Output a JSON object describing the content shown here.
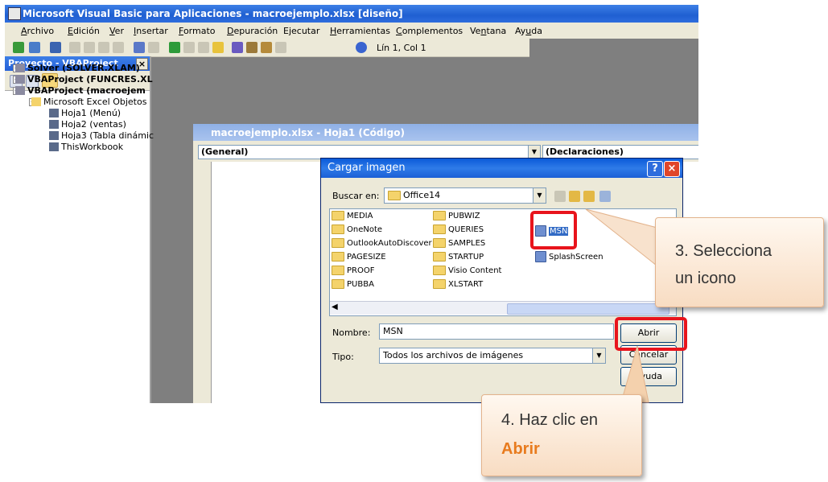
{
  "window": {
    "title": "Microsoft Visual Basic para Aplicaciones - macroejemplo.xlsx [diseño]"
  },
  "menu": [
    {
      "pre": "",
      "u": "A",
      "post": "rchivo"
    },
    {
      "pre": "",
      "u": "E",
      "post": "dición"
    },
    {
      "pre": "",
      "u": "V",
      "post": "er"
    },
    {
      "pre": "",
      "u": "I",
      "post": "nsertar"
    },
    {
      "pre": "",
      "u": "F",
      "post": "ormato"
    },
    {
      "pre": "",
      "u": "D",
      "post": "epuración"
    },
    {
      "pre": "E",
      "u": "j",
      "post": "ecutar"
    },
    {
      "pre": "",
      "u": "H",
      "post": "erramientas"
    },
    {
      "pre": "",
      "u": "C",
      "post": "omplementos"
    },
    {
      "pre": "Ve",
      "u": "n",
      "post": "tana"
    },
    {
      "pre": "Ay",
      "u": "u",
      "post": "da"
    }
  ],
  "toolbar": {
    "cursor_position": "Lín 1, Col 1"
  },
  "project_panel": {
    "title": "Proyecto - VBAProject",
    "close": "×",
    "tree": [
      {
        "label": "Solver (SOLVER.XLAM)",
        "bold": true
      },
      {
        "label": "VBAProject (FUNCRES.XL",
        "bold": true
      },
      {
        "label": "VBAProject (macroejem",
        "bold": true
      },
      {
        "label": "Microsoft Excel Objetos",
        "bold": false
      },
      {
        "label": "Hoja1 (Menú)",
        "bold": false
      },
      {
        "label": "Hoja2 (ventas)",
        "bold": false
      },
      {
        "label": "Hoja3 (Tabla dinámic",
        "bold": false
      },
      {
        "label": "ThisWorkbook",
        "bold": false
      }
    ]
  },
  "code_window": {
    "title": "macroejemplo.xlsx - Hoja1 (Código)",
    "object_combo": "(General)",
    "procedure_combo": "(Declaraciones)"
  },
  "dialog": {
    "title": "Cargar imagen",
    "help_btn": "?",
    "close_btn": "×",
    "look_in_label": "Buscar en:",
    "look_in_value": "Office14",
    "folders_col1": [
      "MEDIA",
      "OneNote",
      "OutlookAutoDiscover",
      "PAGESIZE",
      "PROOF",
      "PUBBA"
    ],
    "folders_col2": [
      "PUBWIZ",
      "QUERIES",
      "SAMPLES",
      "STARTUP",
      "Visio Content",
      "XLSTART"
    ],
    "files_col3": [
      "MSN",
      "SplashScreen"
    ],
    "name_label": "Nombre:",
    "name_value": "MSN",
    "type_label": "Tipo:",
    "type_value": "Todos los archivos de imágenes",
    "open_btn": "Abrir",
    "cancel_btn": "Cancelar",
    "help_button": "Ayuda"
  },
  "callouts": {
    "step3_line1": "3. Selecciona",
    "step3_line2": "un icono",
    "step4_line1": "4. Haz clic en",
    "step4_line2": "Abrir"
  },
  "colors": {
    "highlight": "#e8141c",
    "callout_accent": "#e87b1e",
    "title_blue": "#1f5fd1"
  }
}
